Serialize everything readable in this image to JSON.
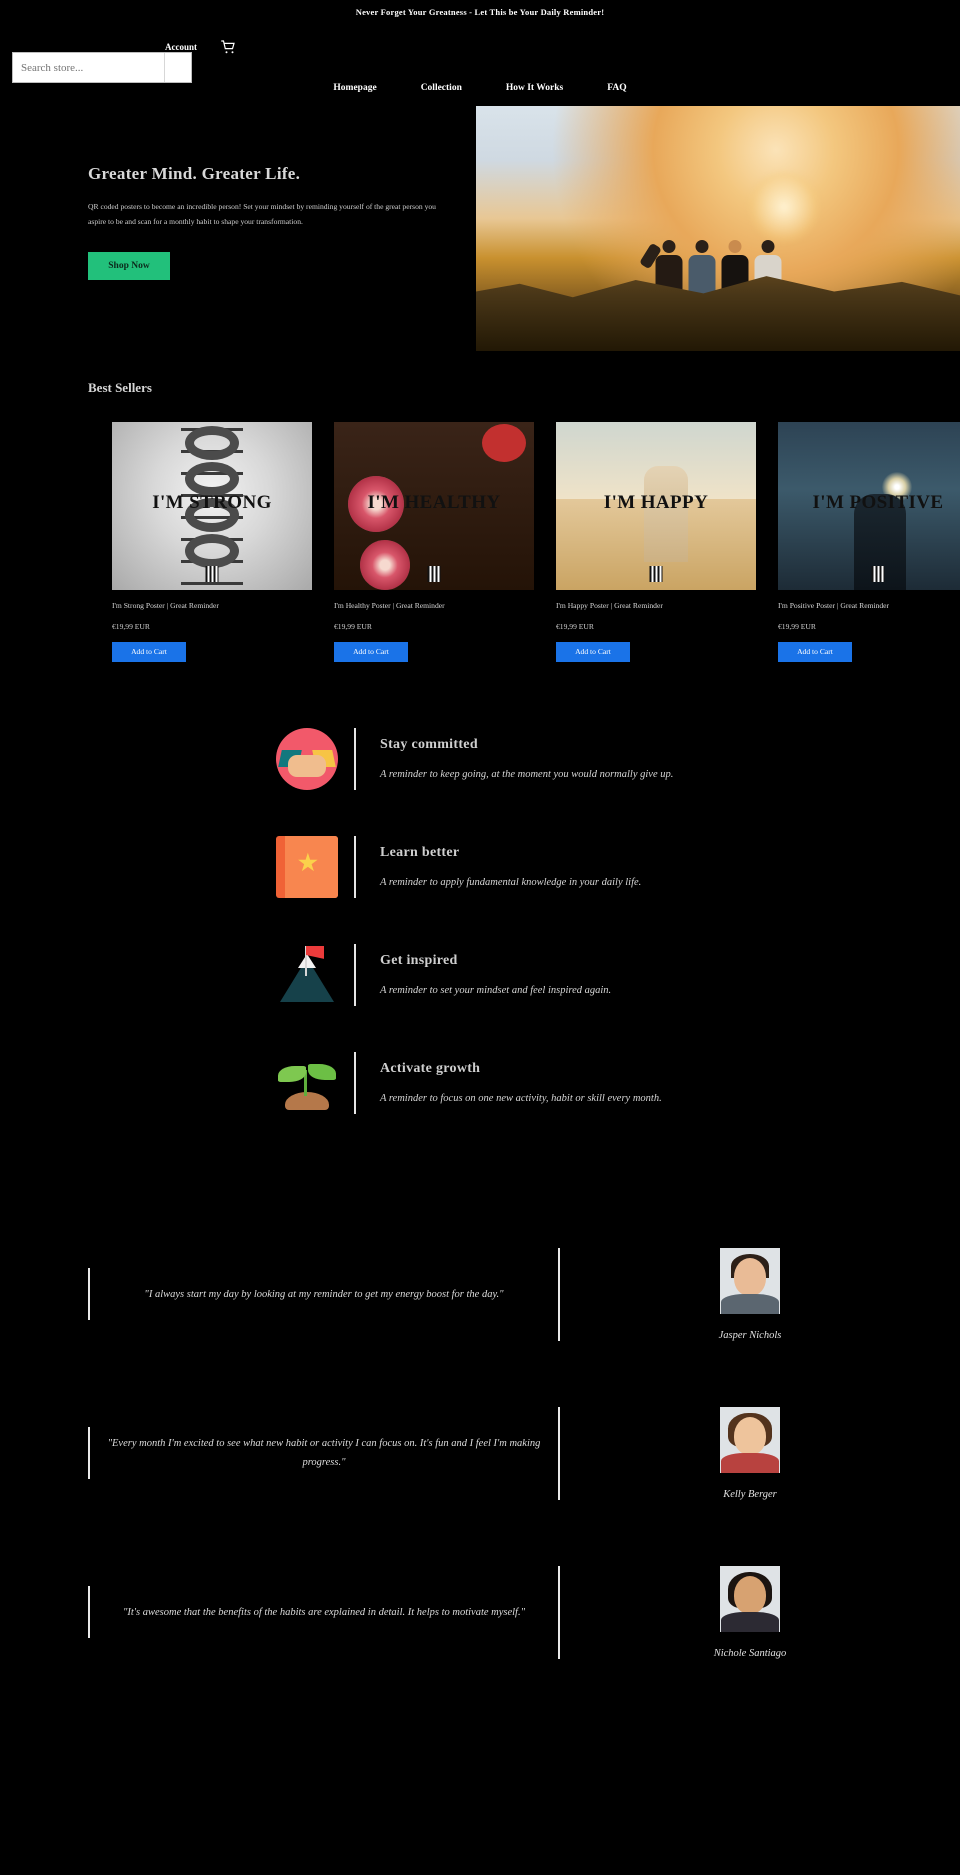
{
  "announcement": {
    "text": "Never Forget Your Greatness - Let This be Your Daily Reminder!"
  },
  "header": {
    "search_placeholder": "Search store...",
    "search_value": "",
    "account_label": "Account",
    "cart_label": "Cart",
    "search_icon": "search-icon",
    "cart_icon": "cart-icon"
  },
  "nav": {
    "items": [
      {
        "label": "Homepage"
      },
      {
        "label": "Collection"
      },
      {
        "label": "How It Works"
      },
      {
        "label": "FAQ"
      }
    ]
  },
  "hero": {
    "title": "Greater Mind. Greater Life.",
    "paragraph": "QR coded posters to become an incredible person! Set your mindset by reminding yourself of the great person you aspire to be and scan for a monthly habit to shape your transformation.",
    "cta_label": "Shop Now",
    "cta_color": "#22c07b",
    "image_alt": "friends-embracing-sunset-photo"
  },
  "best_sellers": {
    "title": "Best Sellers",
    "add_to_cart_label": "Add to Cart",
    "products": [
      {
        "poster_text": "I'M STRONG",
        "title": "I'm Strong Poster |  Great Reminder",
        "price": "€19,99 EUR",
        "art": "art-strong"
      },
      {
        "poster_text": "I'M HEALTHY",
        "title": "I'm Healthy Poster |  Great Reminder",
        "price": "€19,99 EUR",
        "art": "art-healthy"
      },
      {
        "poster_text": "I'M HAPPY",
        "title": "I'm Happy Poster |  Great Reminder",
        "price": "€19,99 EUR",
        "art": "art-happy"
      },
      {
        "poster_text": "I'M POSITIVE",
        "title": "I'm Positive Poster |  Great Reminder",
        "price": "€19,99 EUR",
        "art": "art-positive"
      }
    ]
  },
  "features": [
    {
      "icon": "handshake-icon",
      "title": "Stay committed",
      "desc": "A reminder to keep going, at the moment you would normally give up."
    },
    {
      "icon": "book-star-icon",
      "title": "Learn better",
      "desc": "A reminder to apply fundamental knowledge in your daily life."
    },
    {
      "icon": "mountain-flag-icon",
      "title": "Get inspired",
      "desc": "A reminder to set your mindset and feel inspired again."
    },
    {
      "icon": "seedling-icon",
      "title": "Activate growth",
      "desc": "A reminder to focus on one new activity, habit or skill every month."
    }
  ],
  "testimonials": [
    {
      "quote": "\"I always start my day by looking at my reminder to get my energy boost for the day.\"",
      "name": "Jasper Nichols",
      "avatar": "a1"
    },
    {
      "quote": "\"Every month I'm excited to see what new habit or activity I can focus on. It's fun and I feel I'm making progress.\"",
      "name": "Kelly Berger",
      "avatar": "a2"
    },
    {
      "quote": "\"It's awesome that the benefits of the habits are explained in detail. It helps to motivate myself.\"",
      "name": "Nichole Santiago",
      "avatar": "a3"
    }
  ]
}
